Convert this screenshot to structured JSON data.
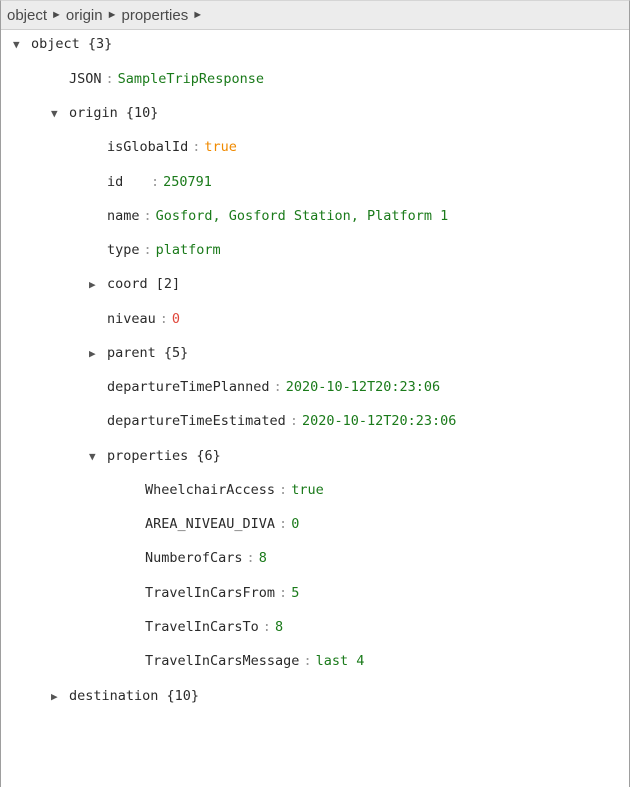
{
  "breadcrumb": [
    {
      "label": "object"
    },
    {
      "label": "origin"
    },
    {
      "label": "properties"
    }
  ],
  "breadcrumb_separator": "►",
  "tree": {
    "root": {
      "key": "object",
      "count": "{3}"
    },
    "json": {
      "key": "JSON",
      "value": "SampleTripResponse"
    },
    "origin": {
      "key": "origin",
      "count": "{10}",
      "isGlobalId": {
        "key": "isGlobalId",
        "value": "true"
      },
      "id": {
        "key": "id",
        "value": "250791"
      },
      "name": {
        "key": "name",
        "value": "Gosford, Gosford Station, Platform 1"
      },
      "type": {
        "key": "type",
        "value": "platform"
      },
      "coord": {
        "key": "coord",
        "count": "[2]"
      },
      "niveau": {
        "key": "niveau",
        "value": "0"
      },
      "parent": {
        "key": "parent",
        "count": "{5}"
      },
      "departureTimePlanned": {
        "key": "departureTimePlanned",
        "value": "2020-10-12T20:23:06"
      },
      "departureTimeEstimated": {
        "key": "departureTimeEstimated",
        "value": "2020-10-12T20:23:06"
      },
      "properties": {
        "key": "properties",
        "count": "{6}",
        "WheelchairAccess": {
          "key": "WheelchairAccess",
          "value": "true"
        },
        "AREA_NIVEAU_DIVA": {
          "key": "AREA_NIVEAU_DIVA",
          "value": "0"
        },
        "NumberofCars": {
          "key": "NumberofCars",
          "value": "8"
        },
        "TravelInCarsFrom": {
          "key": "TravelInCarsFrom",
          "value": "5"
        },
        "TravelInCarsTo": {
          "key": "TravelInCarsTo",
          "value": "8"
        },
        "TravelInCarsMessage": {
          "key": "TravelInCarsMessage",
          "value": "last 4"
        }
      }
    },
    "destination": {
      "key": "destination",
      "count": "{10}"
    }
  },
  "icons": {
    "expanded": "▼",
    "collapsed": "▶",
    "separator": "►"
  },
  "colors": {
    "string_value": "#1a7a1a",
    "boolean_value": "#f08a00",
    "zero_value": "#e0463a",
    "key_text": "#2a2a2a",
    "colon": "#999999",
    "breadcrumb_bg": "#ececec"
  }
}
